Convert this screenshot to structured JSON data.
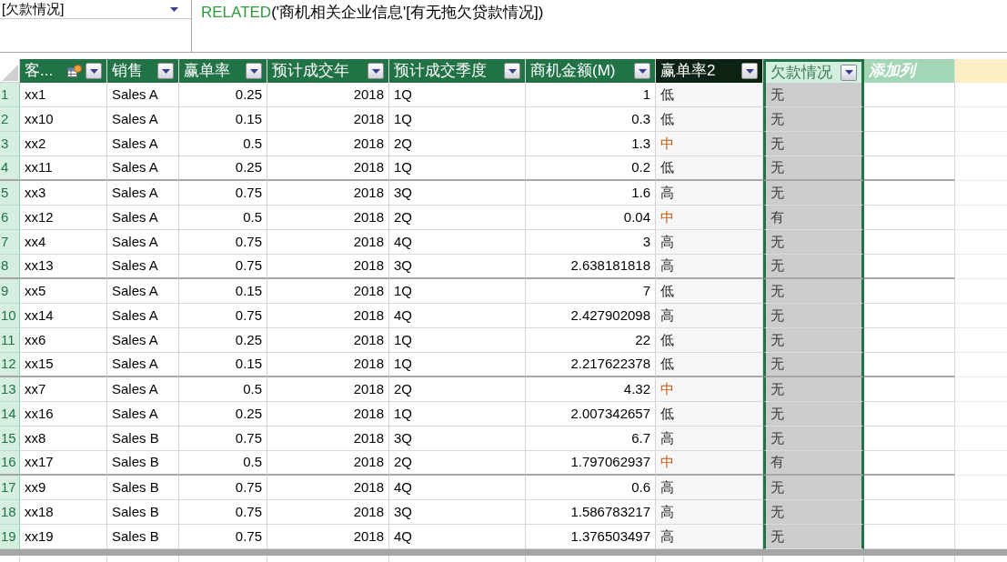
{
  "name_box": {
    "value": "[欠款情况]"
  },
  "formula_bar": {
    "function": "RELATED",
    "arguments": "('商机相关企业信息'[有无拖欠贷款情况])"
  },
  "columns": [
    {
      "label": "客...",
      "kind": "text",
      "linked": true,
      "selected": false
    },
    {
      "label": "销售",
      "kind": "text",
      "linked": false,
      "selected": false
    },
    {
      "label": "赢单率",
      "kind": "number",
      "linked": false,
      "selected": false
    },
    {
      "label": "预计成交年",
      "kind": "number",
      "linked": false,
      "selected": false
    },
    {
      "label": "预计成交季度",
      "kind": "text",
      "linked": false,
      "selected": false
    },
    {
      "label": "商机金额(M)",
      "kind": "number",
      "linked": false,
      "selected": false
    },
    {
      "label": "赢单率2",
      "kind": "calculated",
      "linked": false,
      "selected": false
    },
    {
      "label": "欠款情况",
      "kind": "text",
      "linked": false,
      "selected": true
    },
    {
      "label": "添加列",
      "kind": "add",
      "linked": false,
      "selected": false
    }
  ],
  "rows": [
    {
      "number": "1",
      "cells": [
        "xx1",
        "Sales A",
        "0.25",
        "2018",
        "1Q",
        "1",
        "低",
        "无"
      ],
      "color": "#262626"
    },
    {
      "number": "2",
      "cells": [
        "xx10",
        "Sales A",
        "0.15",
        "2018",
        "1Q",
        "0.3",
        "低",
        "无"
      ],
      "color": "#262626"
    },
    {
      "number": "3",
      "cells": [
        "xx2",
        "Sales A",
        "0.5",
        "2018",
        "2Q",
        "1.3",
        "中",
        "无"
      ],
      "color": "#c55a11"
    },
    {
      "number": "4",
      "cells": [
        "xx11",
        "Sales A",
        "0.25",
        "2018",
        "1Q",
        "0.2",
        "低",
        "无"
      ],
      "color": "#262626"
    },
    {
      "number": "5",
      "cells": [
        "xx3",
        "Sales A",
        "0.75",
        "2018",
        "3Q",
        "1.6",
        "高",
        "无"
      ],
      "color": "#262626"
    },
    {
      "number": "6",
      "cells": [
        "xx12",
        "Sales A",
        "0.5",
        "2018",
        "2Q",
        "0.04",
        "中",
        "有"
      ],
      "color": "#c55a11"
    },
    {
      "number": "7",
      "cells": [
        "xx4",
        "Sales A",
        "0.75",
        "2018",
        "4Q",
        "3",
        "高",
        "无"
      ],
      "color": "#262626"
    },
    {
      "number": "8",
      "cells": [
        "xx13",
        "Sales A",
        "0.75",
        "2018",
        "3Q",
        "2.638181818",
        "高",
        "无"
      ],
      "color": "#262626"
    },
    {
      "number": "9",
      "cells": [
        "xx5",
        "Sales A",
        "0.15",
        "2018",
        "1Q",
        "7",
        "低",
        "无"
      ],
      "color": "#262626"
    },
    {
      "number": "10",
      "cells": [
        "xx14",
        "Sales A",
        "0.75",
        "2018",
        "4Q",
        "2.427902098",
        "高",
        "无"
      ],
      "color": "#262626"
    },
    {
      "number": "11",
      "cells": [
        "xx6",
        "Sales A",
        "0.25",
        "2018",
        "1Q",
        "22",
        "低",
        "无"
      ],
      "color": "#262626"
    },
    {
      "number": "12",
      "cells": [
        "xx15",
        "Sales A",
        "0.15",
        "2018",
        "1Q",
        "2.217622378",
        "低",
        "无"
      ],
      "color": "#262626"
    },
    {
      "number": "13",
      "cells": [
        "xx7",
        "Sales A",
        "0.5",
        "2018",
        "2Q",
        "4.32",
        "中",
        "无"
      ],
      "color": "#c55a11"
    },
    {
      "number": "14",
      "cells": [
        "xx16",
        "Sales A",
        "0.25",
        "2018",
        "1Q",
        "2.007342657",
        "低",
        "无"
      ],
      "color": "#262626"
    },
    {
      "number": "15",
      "cells": [
        "xx8",
        "Sales B",
        "0.75",
        "2018",
        "3Q",
        "6.7",
        "高",
        "无"
      ],
      "color": "#262626"
    },
    {
      "number": "16",
      "cells": [
        "xx17",
        "Sales B",
        "0.5",
        "2018",
        "2Q",
        "1.797062937",
        "中",
        "有"
      ],
      "color": "#c55a11"
    },
    {
      "number": "17",
      "cells": [
        "xx9",
        "Sales B",
        "0.75",
        "2018",
        "4Q",
        "0.6",
        "高",
        "无"
      ],
      "color": "#262626"
    },
    {
      "number": "18",
      "cells": [
        "xx18",
        "Sales B",
        "0.75",
        "2018",
        "3Q",
        "1.586783217",
        "高",
        "无"
      ],
      "color": "#262626"
    },
    {
      "number": "19",
      "cells": [
        "xx19",
        "Sales B",
        "0.75",
        "2018",
        "4Q",
        "1.376503497",
        "高",
        "无"
      ],
      "color": "#262626"
    }
  ]
}
